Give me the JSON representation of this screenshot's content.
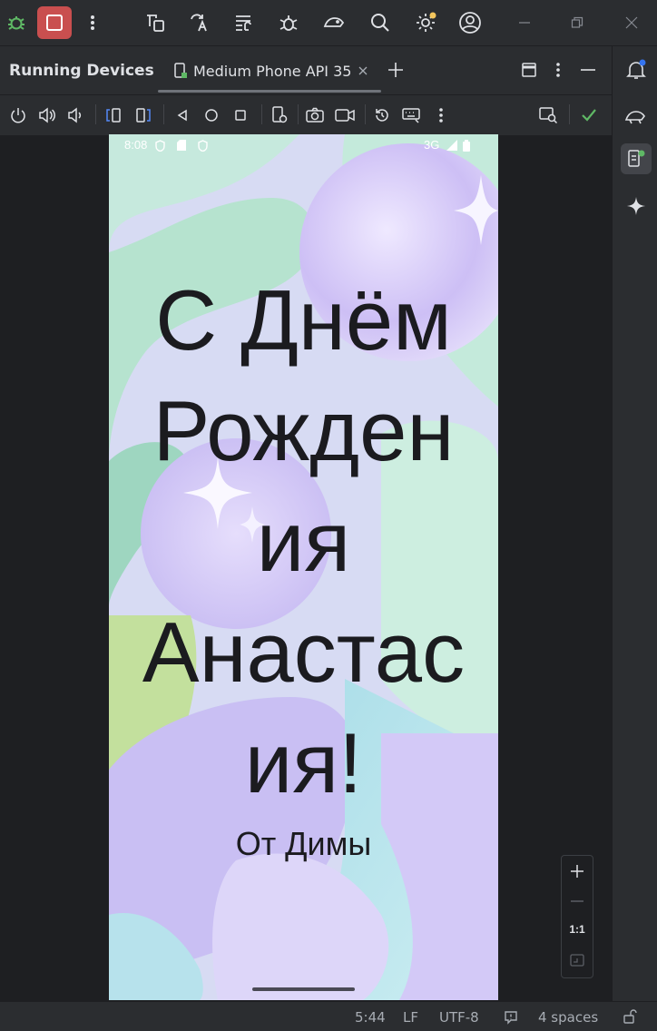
{
  "panel": {
    "title": "Running Devices",
    "tab_label": "Medium Phone API 35"
  },
  "phone_status": {
    "time": "8:08",
    "network": "3G"
  },
  "greeting": {
    "line1": "С Днём",
    "line2": "Рожден",
    "line3": "ия",
    "line4": "Анастас",
    "line5": "ия!",
    "signature": "От Димы"
  },
  "zoom": {
    "one_to_one": "1:1"
  },
  "status_bar": {
    "position": "5:44",
    "line_ending": "LF",
    "encoding": "UTF-8",
    "indent": "4 spaces"
  },
  "colors": {
    "accent_red": "#c94f4f",
    "notification_dot": "#3574f0",
    "warning_dot": "#f2c55c",
    "check_green": "#5fb865"
  }
}
